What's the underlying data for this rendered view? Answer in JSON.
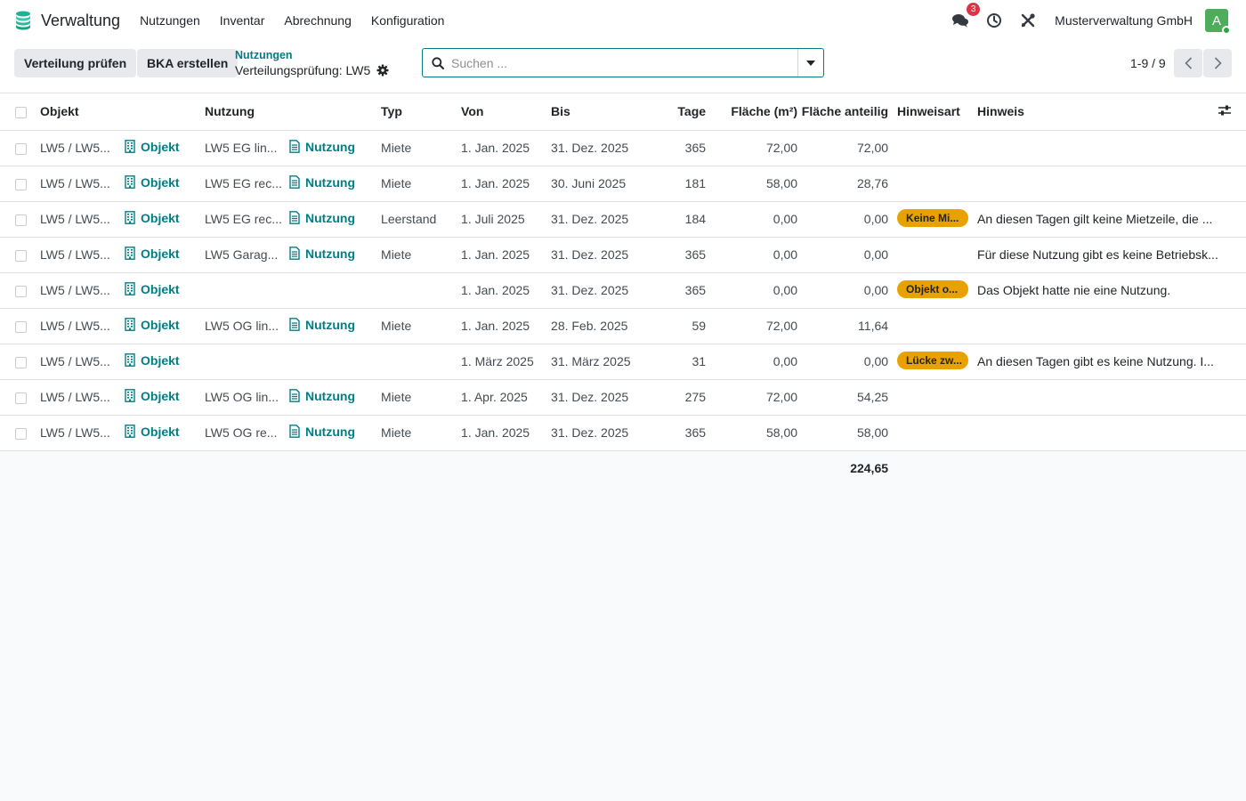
{
  "app": {
    "name": "Verwaltung"
  },
  "menu": [
    "Nutzungen",
    "Inventar",
    "Abrechnung",
    "Konfiguration"
  ],
  "systray": {
    "message_count": "3",
    "company": "Musterverwaltung GmbH",
    "avatar_letter": "A"
  },
  "actions": {
    "primary": "Verteilung prüfen",
    "secondary": "BKA erstellen"
  },
  "breadcrumb": {
    "parent": "Nutzungen",
    "current": "Verteilungsprüfung: LW5"
  },
  "search": {
    "placeholder": "Suchen ..."
  },
  "pager": {
    "value": "1-9 / 9"
  },
  "table": {
    "headers": {
      "objekt": "Objekt",
      "nutzung": "Nutzung",
      "typ": "Typ",
      "von": "Von",
      "bis": "Bis",
      "tage": "Tage",
      "flaeche": "Fläche (m²)",
      "anteilig": "Fläche anteilig",
      "hinweisart": "Hinweisart",
      "hinweis": "Hinweis"
    },
    "objekt_link_label": "Objekt",
    "nutzung_link_label": "Nutzung",
    "rows": [
      {
        "objekt": "LW5 / LW5...",
        "nutzung": "LW5 EG lin...",
        "typ": "Miete",
        "von": "1. Jan. 2025",
        "bis": "31. Dez. 2025",
        "tage": "365",
        "flaeche": "72,00",
        "anteilig": "72,00",
        "hinweisart": "",
        "hinweis": ""
      },
      {
        "objekt": "LW5 / LW5...",
        "nutzung": "LW5 EG rec...",
        "typ": "Miete",
        "von": "1. Jan. 2025",
        "bis": "30. Juni 2025",
        "tage": "181",
        "flaeche": "58,00",
        "anteilig": "28,76",
        "hinweisart": "",
        "hinweis": ""
      },
      {
        "objekt": "LW5 / LW5...",
        "nutzung": "LW5 EG rec...",
        "typ": "Leerstand",
        "von": "1. Juli 2025",
        "bis": "31. Dez. 2025",
        "tage": "184",
        "flaeche": "0,00",
        "anteilig": "0,00",
        "hinweisart": "Keine Mi...",
        "hinweis": "An diesen Tagen gilt keine Mietzeile, die ..."
      },
      {
        "objekt": "LW5 / LW5...",
        "nutzung": "LW5 Garag...",
        "typ": "Miete",
        "von": "1. Jan. 2025",
        "bis": "31. Dez. 2025",
        "tage": "365",
        "flaeche": "0,00",
        "anteilig": "0,00",
        "hinweisart": "",
        "hinweis": "Für diese Nutzung gibt es keine Betriebsk..."
      },
      {
        "objekt": "LW5 / LW5...",
        "nutzung": "",
        "typ": "",
        "von": "1. Jan. 2025",
        "bis": "31. Dez. 2025",
        "tage": "365",
        "flaeche": "0,00",
        "anteilig": "0,00",
        "hinweisart": "Objekt o...",
        "hinweis": "Das Objekt hatte nie eine Nutzung."
      },
      {
        "objekt": "LW5 / LW5...",
        "nutzung": "LW5 OG lin...",
        "typ": "Miete",
        "von": "1. Jan. 2025",
        "bis": "28. Feb. 2025",
        "tage": "59",
        "flaeche": "72,00",
        "anteilig": "11,64",
        "hinweisart": "",
        "hinweis": ""
      },
      {
        "objekt": "LW5 / LW5...",
        "nutzung": "",
        "typ": "",
        "von": "1. März 2025",
        "bis": "31. März 2025",
        "tage": "31",
        "flaeche": "0,00",
        "anteilig": "0,00",
        "hinweisart": "Lücke zw...",
        "hinweis": "An diesen Tagen gibt es keine Nutzung. I..."
      },
      {
        "objekt": "LW5 / LW5...",
        "nutzung": "LW5 OG lin...",
        "typ": "Miete",
        "von": "1. Apr. 2025",
        "bis": "31. Dez. 2025",
        "tage": "275",
        "flaeche": "72,00",
        "anteilig": "54,25",
        "hinweisart": "",
        "hinweis": ""
      },
      {
        "objekt": "LW5 / LW5...",
        "nutzung": "LW5 OG re...",
        "typ": "Miete",
        "von": "1. Jan. 2025",
        "bis": "31. Dez. 2025",
        "tage": "365",
        "flaeche": "58,00",
        "anteilig": "58,00",
        "hinweisart": "",
        "hinweis": ""
      }
    ],
    "total_anteilig": "224,65"
  },
  "colors": {
    "accent": "#017e84",
    "badge": "#e9a100",
    "notification": "#dc3545",
    "avatar": "#4ead5b"
  }
}
